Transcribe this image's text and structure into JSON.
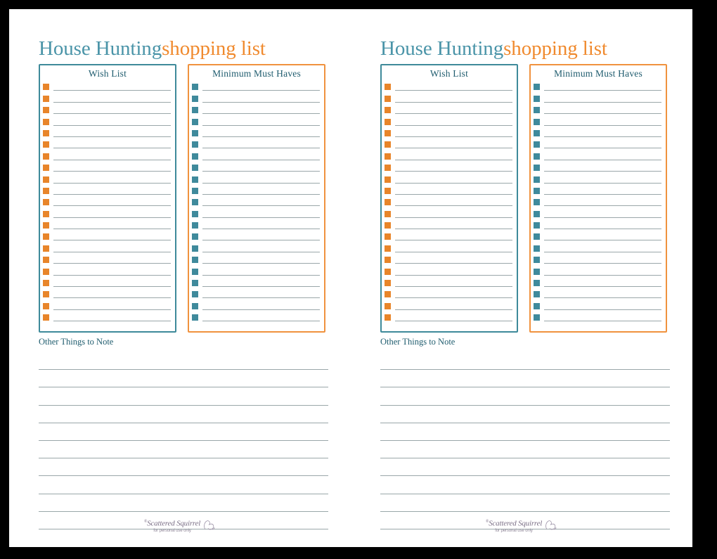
{
  "document": {
    "page_background": "#ffffff",
    "outer_background": "#000000",
    "page_count": 2
  },
  "colors": {
    "title_teal": "#4a94a8",
    "title_orange": "#f08a2e",
    "header_text": "#1f5c6e",
    "wish_border": "#3e8a9a",
    "must_border": "#f0923e",
    "wish_bullet": "#e8852a",
    "must_bullet": "#3f8a9c",
    "rule_line": "#9aa7a9",
    "footer_text": "#7b6f86"
  },
  "title": {
    "primary": "House Hunting",
    "accent": "shopping list"
  },
  "boxes": [
    {
      "id": "wish-list",
      "header": "Wish List",
      "bullet_icon": "orange-square-bullet",
      "row_count": 21,
      "border_color": "#3e8a9a",
      "bullet_color": "#e8852a"
    },
    {
      "id": "minimum-must-haves",
      "header": "Minimum Must Haves",
      "bullet_icon": "teal-square-bullet",
      "row_count": 21,
      "border_color": "#f0923e",
      "bullet_color": "#3f8a9c"
    }
  ],
  "notes": {
    "label": "Other Things to Note",
    "line_count": 10
  },
  "footer": {
    "registered_mark": "®",
    "brand": "Scattered Squirrel",
    "subtitle": "for personal use only",
    "icon": "squirrel-icon"
  }
}
